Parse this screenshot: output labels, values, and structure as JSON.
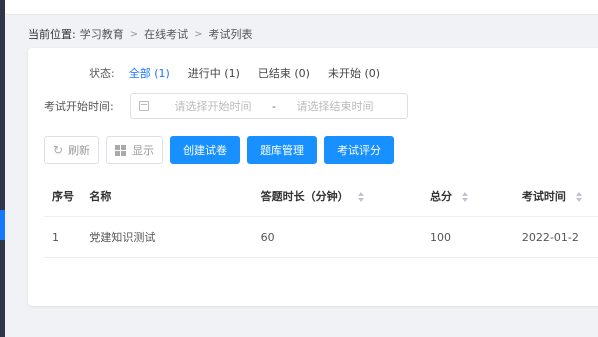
{
  "breadcrumb": {
    "label": "当前位置:",
    "items": [
      "学习教育",
      "在线考试",
      "考试列表"
    ]
  },
  "filters": {
    "status_label": "状态:",
    "status_options": [
      "全部 (1)",
      "进行中 (1)",
      "已结束 (0)",
      "未开始 (0)"
    ],
    "active_status": "全部 (1)",
    "date_label": "考试开始时间:",
    "start_placeholder": "请选择开始时间",
    "separator": "-",
    "end_placeholder": "请选择结束时间"
  },
  "toolbar": {
    "refresh": "刷新",
    "display": "显示",
    "create": "创建试卷",
    "bank": "题库管理",
    "grade": "考试评分"
  },
  "table": {
    "headers": [
      "序号",
      "名称",
      "答题时长（分钟）",
      "总分",
      "考试时间"
    ],
    "rows": [
      [
        "1",
        "党建知识测试",
        "60",
        "100",
        "2022-01-2"
      ]
    ]
  },
  "colors": {
    "primary": "#1890ff",
    "active_text": "#1677ff",
    "nav_dark": "#2f3546"
  }
}
